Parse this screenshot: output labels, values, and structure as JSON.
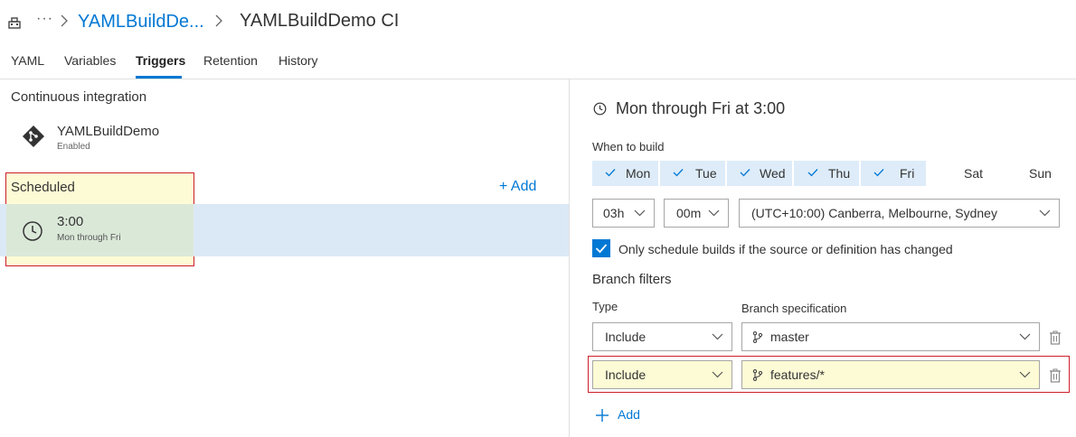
{
  "breadcrumb": {
    "more": "···",
    "project": "YAMLBuildDe...",
    "pipeline": "YAMLBuildDemo CI"
  },
  "tabs": [
    {
      "label": "YAML",
      "active": false
    },
    {
      "label": "Variables",
      "active": false
    },
    {
      "label": "Triggers",
      "active": true
    },
    {
      "label": "Retention",
      "active": false
    },
    {
      "label": "History",
      "active": false
    }
  ],
  "left": {
    "ci_title": "Continuous integration",
    "ci_repo": {
      "name": "YAMLBuildDemo",
      "status": "Enabled",
      "icon": "git-icon"
    },
    "scheduled_title": "Scheduled",
    "add_label": "+ Add",
    "schedule": {
      "time": "3:00",
      "days": "Mon through Fri",
      "icon": "clock-icon"
    }
  },
  "right": {
    "title": "Mon through Fri at 3:00",
    "when_label": "When to build",
    "days": [
      {
        "label": "Mon",
        "checked": true
      },
      {
        "label": "Tue",
        "checked": true
      },
      {
        "label": "Wed",
        "checked": true
      },
      {
        "label": "Thu",
        "checked": true
      },
      {
        "label": "Fri",
        "checked": true
      },
      {
        "label": "Sat",
        "checked": false
      },
      {
        "label": "Sun",
        "checked": false
      }
    ],
    "hour": "03h",
    "minute": "00m",
    "timezone": "(UTC+10:00) Canberra, Melbourne, Sydney",
    "only_changed": {
      "label": "Only schedule builds if the source or definition has changed",
      "checked": true
    },
    "branch_filters_title": "Branch filters",
    "type_header": "Type",
    "spec_header": "Branch specification",
    "filters": [
      {
        "type": "Include",
        "branch": "master"
      },
      {
        "type": "Include",
        "branch": "features/*"
      }
    ],
    "add_label": "Add"
  },
  "colors": {
    "accent": "#0078d4",
    "highlight_yellow": "#fdfbd5",
    "highlight_border": "#cc1f2a",
    "selected_row": "#dbe9f6"
  }
}
